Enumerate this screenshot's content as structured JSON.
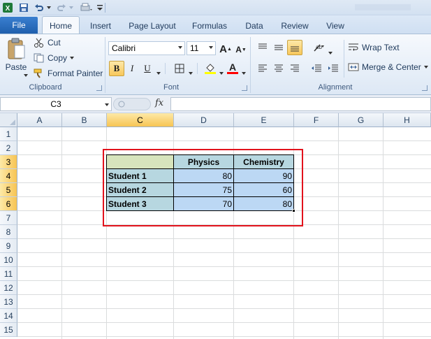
{
  "window": {
    "title": "Book1 - Microsoft Excel"
  },
  "qat": {
    "icons": [
      "excel-logo-icon",
      "save-icon",
      "undo-icon",
      "redo-icon",
      "customize-icon"
    ]
  },
  "tabs": {
    "file": "File",
    "items": [
      "Home",
      "Insert",
      "Page Layout",
      "Formulas",
      "Data",
      "Review",
      "View"
    ],
    "active": "Home"
  },
  "clipboard": {
    "paste": "Paste",
    "cut": "Cut",
    "copy": "Copy",
    "format_painter": "Format Painter",
    "label": "Clipboard"
  },
  "font": {
    "family": "Calibri",
    "size": "11",
    "bold": "B",
    "italic": "I",
    "underline": "U",
    "label": "Font",
    "grow": "A",
    "shrink": "A",
    "color": "A",
    "fill_color": "#ffff00",
    "font_color": "#ff0000"
  },
  "alignment": {
    "wrap_text": "Wrap Text",
    "merge_center": "Merge & Center",
    "label": "Alignment"
  },
  "formula_bar": {
    "name_box": "C3",
    "fx": "fx",
    "value": ""
  },
  "grid": {
    "columns": [
      "A",
      "B",
      "C",
      "D",
      "E",
      "F",
      "G",
      "H"
    ],
    "rows": [
      "1",
      "2",
      "3",
      "4",
      "5",
      "6",
      "7",
      "8",
      "9",
      "10",
      "11",
      "12",
      "13",
      "14",
      "15"
    ],
    "selected_column": "C",
    "selected_rows": [
      "3",
      "4",
      "5",
      "6"
    ]
  },
  "table": {
    "headers": [
      "",
      "Physics",
      "Chemistry"
    ],
    "rows": [
      {
        "name": "Student 1",
        "physics": "80",
        "chemistry": "90"
      },
      {
        "name": "Student 2",
        "physics": "75",
        "chemistry": "60"
      },
      {
        "name": "Student 3",
        "physics": "70",
        "chemistry": "80"
      }
    ]
  },
  "colors": {
    "highlight_border": "#e2121c",
    "header_fill": "#b7d7e0",
    "value_fill": "#bcd8f4",
    "corner_fill": "#d7e4bc"
  }
}
